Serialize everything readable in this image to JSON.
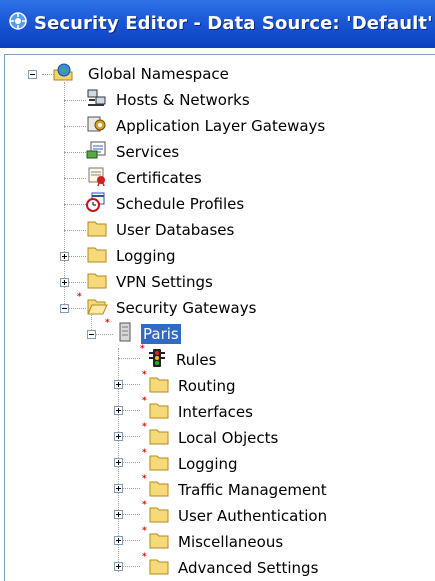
{
  "window": {
    "title": "Security Editor - Data Source: 'Default'"
  },
  "tree": {
    "root": {
      "label": "Global Namespace"
    },
    "items": [
      {
        "label": "Hosts & Networks"
      },
      {
        "label": "Application Layer Gateways"
      },
      {
        "label": "Services"
      },
      {
        "label": "Certificates"
      },
      {
        "label": "Schedule Profiles"
      },
      {
        "label": "User Databases"
      },
      {
        "label": "Logging"
      },
      {
        "label": "VPN Settings"
      },
      {
        "label": "Security Gateways"
      }
    ],
    "gateway": {
      "label": "Paris"
    },
    "gateway_items": [
      {
        "label": "Rules"
      },
      {
        "label": "Routing"
      },
      {
        "label": "Interfaces"
      },
      {
        "label": "Local Objects"
      },
      {
        "label": "Logging"
      },
      {
        "label": "Traffic Management"
      },
      {
        "label": "User Authentication"
      },
      {
        "label": "Miscellaneous"
      },
      {
        "label": "Advanced Settings"
      }
    ]
  },
  "colors": {
    "titlebar": "#0a3fc0",
    "selection": "#316ac5",
    "modified_marker": "#e01010"
  }
}
